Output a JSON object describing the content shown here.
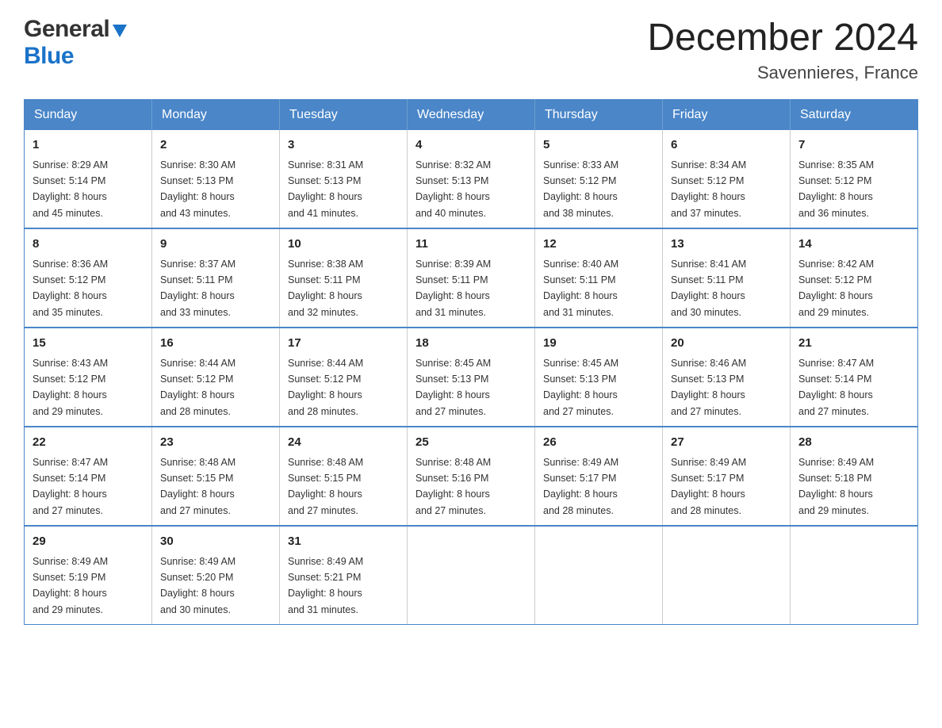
{
  "header": {
    "logo": {
      "general": "General",
      "blue": "Blue",
      "tagline": ""
    },
    "title": "December 2024",
    "location": "Savennieres, France"
  },
  "columns": [
    "Sunday",
    "Monday",
    "Tuesday",
    "Wednesday",
    "Thursday",
    "Friday",
    "Saturday"
  ],
  "weeks": [
    [
      {
        "day": "1",
        "sunrise": "Sunrise: 8:29 AM",
        "sunset": "Sunset: 5:14 PM",
        "daylight": "Daylight: 8 hours",
        "daylight2": "and 45 minutes."
      },
      {
        "day": "2",
        "sunrise": "Sunrise: 8:30 AM",
        "sunset": "Sunset: 5:13 PM",
        "daylight": "Daylight: 8 hours",
        "daylight2": "and 43 minutes."
      },
      {
        "day": "3",
        "sunrise": "Sunrise: 8:31 AM",
        "sunset": "Sunset: 5:13 PM",
        "daylight": "Daylight: 8 hours",
        "daylight2": "and 41 minutes."
      },
      {
        "day": "4",
        "sunrise": "Sunrise: 8:32 AM",
        "sunset": "Sunset: 5:13 PM",
        "daylight": "Daylight: 8 hours",
        "daylight2": "and 40 minutes."
      },
      {
        "day": "5",
        "sunrise": "Sunrise: 8:33 AM",
        "sunset": "Sunset: 5:12 PM",
        "daylight": "Daylight: 8 hours",
        "daylight2": "and 38 minutes."
      },
      {
        "day": "6",
        "sunrise": "Sunrise: 8:34 AM",
        "sunset": "Sunset: 5:12 PM",
        "daylight": "Daylight: 8 hours",
        "daylight2": "and 37 minutes."
      },
      {
        "day": "7",
        "sunrise": "Sunrise: 8:35 AM",
        "sunset": "Sunset: 5:12 PM",
        "daylight": "Daylight: 8 hours",
        "daylight2": "and 36 minutes."
      }
    ],
    [
      {
        "day": "8",
        "sunrise": "Sunrise: 8:36 AM",
        "sunset": "Sunset: 5:12 PM",
        "daylight": "Daylight: 8 hours",
        "daylight2": "and 35 minutes."
      },
      {
        "day": "9",
        "sunrise": "Sunrise: 8:37 AM",
        "sunset": "Sunset: 5:11 PM",
        "daylight": "Daylight: 8 hours",
        "daylight2": "and 33 minutes."
      },
      {
        "day": "10",
        "sunrise": "Sunrise: 8:38 AM",
        "sunset": "Sunset: 5:11 PM",
        "daylight": "Daylight: 8 hours",
        "daylight2": "and 32 minutes."
      },
      {
        "day": "11",
        "sunrise": "Sunrise: 8:39 AM",
        "sunset": "Sunset: 5:11 PM",
        "daylight": "Daylight: 8 hours",
        "daylight2": "and 31 minutes."
      },
      {
        "day": "12",
        "sunrise": "Sunrise: 8:40 AM",
        "sunset": "Sunset: 5:11 PM",
        "daylight": "Daylight: 8 hours",
        "daylight2": "and 31 minutes."
      },
      {
        "day": "13",
        "sunrise": "Sunrise: 8:41 AM",
        "sunset": "Sunset: 5:11 PM",
        "daylight": "Daylight: 8 hours",
        "daylight2": "and 30 minutes."
      },
      {
        "day": "14",
        "sunrise": "Sunrise: 8:42 AM",
        "sunset": "Sunset: 5:12 PM",
        "daylight": "Daylight: 8 hours",
        "daylight2": "and 29 minutes."
      }
    ],
    [
      {
        "day": "15",
        "sunrise": "Sunrise: 8:43 AM",
        "sunset": "Sunset: 5:12 PM",
        "daylight": "Daylight: 8 hours",
        "daylight2": "and 29 minutes."
      },
      {
        "day": "16",
        "sunrise": "Sunrise: 8:44 AM",
        "sunset": "Sunset: 5:12 PM",
        "daylight": "Daylight: 8 hours",
        "daylight2": "and 28 minutes."
      },
      {
        "day": "17",
        "sunrise": "Sunrise: 8:44 AM",
        "sunset": "Sunset: 5:12 PM",
        "daylight": "Daylight: 8 hours",
        "daylight2": "and 28 minutes."
      },
      {
        "day": "18",
        "sunrise": "Sunrise: 8:45 AM",
        "sunset": "Sunset: 5:13 PM",
        "daylight": "Daylight: 8 hours",
        "daylight2": "and 27 minutes."
      },
      {
        "day": "19",
        "sunrise": "Sunrise: 8:45 AM",
        "sunset": "Sunset: 5:13 PM",
        "daylight": "Daylight: 8 hours",
        "daylight2": "and 27 minutes."
      },
      {
        "day": "20",
        "sunrise": "Sunrise: 8:46 AM",
        "sunset": "Sunset: 5:13 PM",
        "daylight": "Daylight: 8 hours",
        "daylight2": "and 27 minutes."
      },
      {
        "day": "21",
        "sunrise": "Sunrise: 8:47 AM",
        "sunset": "Sunset: 5:14 PM",
        "daylight": "Daylight: 8 hours",
        "daylight2": "and 27 minutes."
      }
    ],
    [
      {
        "day": "22",
        "sunrise": "Sunrise: 8:47 AM",
        "sunset": "Sunset: 5:14 PM",
        "daylight": "Daylight: 8 hours",
        "daylight2": "and 27 minutes."
      },
      {
        "day": "23",
        "sunrise": "Sunrise: 8:48 AM",
        "sunset": "Sunset: 5:15 PM",
        "daylight": "Daylight: 8 hours",
        "daylight2": "and 27 minutes."
      },
      {
        "day": "24",
        "sunrise": "Sunrise: 8:48 AM",
        "sunset": "Sunset: 5:15 PM",
        "daylight": "Daylight: 8 hours",
        "daylight2": "and 27 minutes."
      },
      {
        "day": "25",
        "sunrise": "Sunrise: 8:48 AM",
        "sunset": "Sunset: 5:16 PM",
        "daylight": "Daylight: 8 hours",
        "daylight2": "and 27 minutes."
      },
      {
        "day": "26",
        "sunrise": "Sunrise: 8:49 AM",
        "sunset": "Sunset: 5:17 PM",
        "daylight": "Daylight: 8 hours",
        "daylight2": "and 28 minutes."
      },
      {
        "day": "27",
        "sunrise": "Sunrise: 8:49 AM",
        "sunset": "Sunset: 5:17 PM",
        "daylight": "Daylight: 8 hours",
        "daylight2": "and 28 minutes."
      },
      {
        "day": "28",
        "sunrise": "Sunrise: 8:49 AM",
        "sunset": "Sunset: 5:18 PM",
        "daylight": "Daylight: 8 hours",
        "daylight2": "and 29 minutes."
      }
    ],
    [
      {
        "day": "29",
        "sunrise": "Sunrise: 8:49 AM",
        "sunset": "Sunset: 5:19 PM",
        "daylight": "Daylight: 8 hours",
        "daylight2": "and 29 minutes."
      },
      {
        "day": "30",
        "sunrise": "Sunrise: 8:49 AM",
        "sunset": "Sunset: 5:20 PM",
        "daylight": "Daylight: 8 hours",
        "daylight2": "and 30 minutes."
      },
      {
        "day": "31",
        "sunrise": "Sunrise: 8:49 AM",
        "sunset": "Sunset: 5:21 PM",
        "daylight": "Daylight: 8 hours",
        "daylight2": "and 31 minutes."
      },
      null,
      null,
      null,
      null
    ]
  ]
}
